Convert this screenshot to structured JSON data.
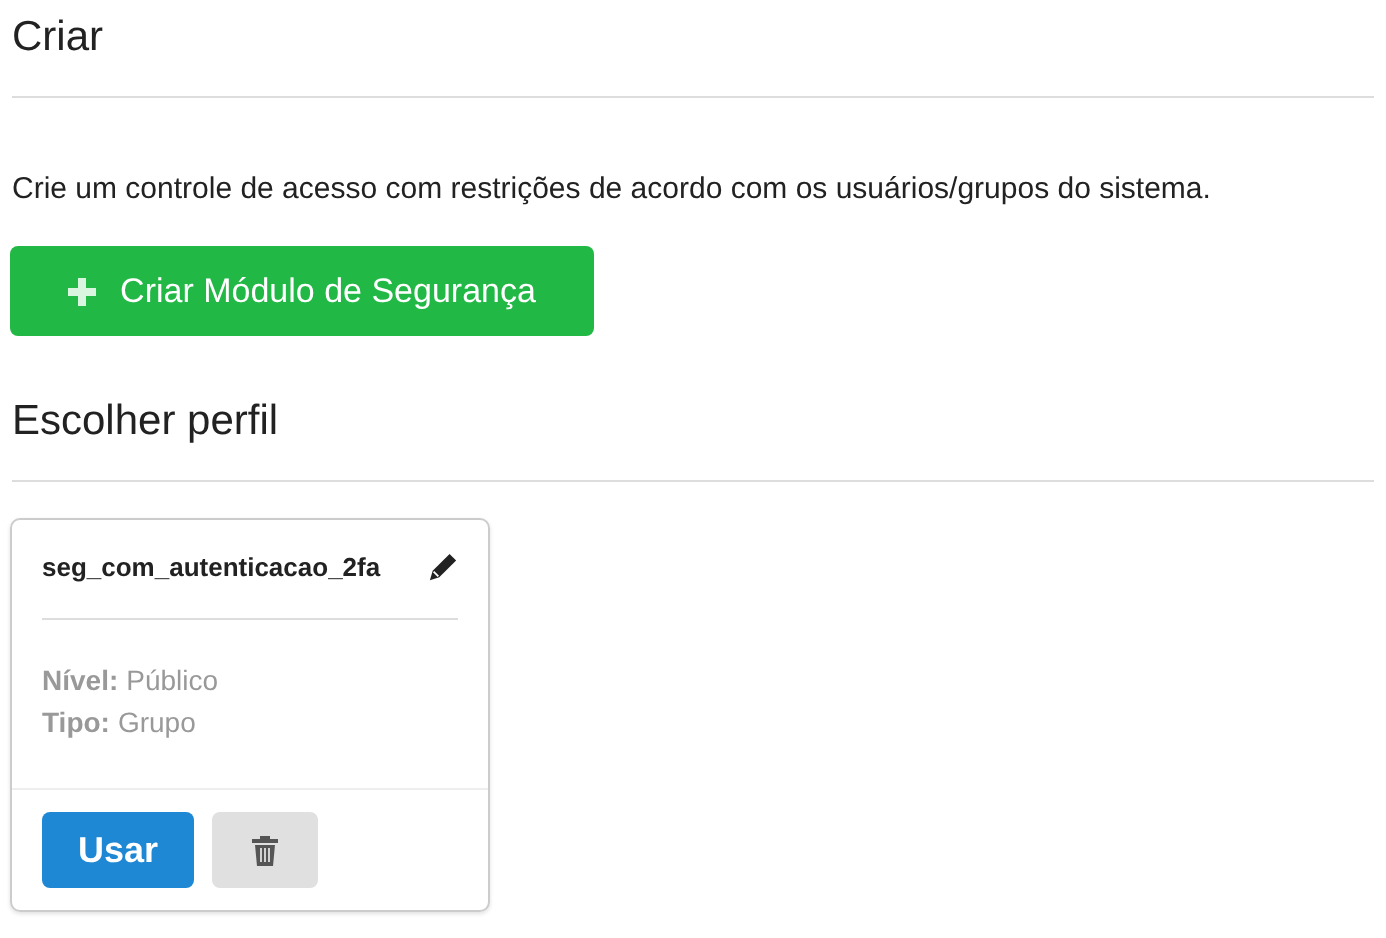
{
  "create_section": {
    "title": "Criar",
    "description": "Crie um controle de acesso com restrições de acordo com os usuários/grupos do sistema.",
    "button": {
      "label": "Criar Módulo de Segurança"
    }
  },
  "profiles_section": {
    "title": "Escolher perfil",
    "profiles": [
      {
        "name": "seg_com_autenticacao_2fa",
        "fields": [
          {
            "label": "Nível:",
            "value": "Público"
          },
          {
            "label": "Tipo:",
            "value": "Grupo"
          }
        ],
        "use_button": "Usar"
      }
    ]
  }
}
